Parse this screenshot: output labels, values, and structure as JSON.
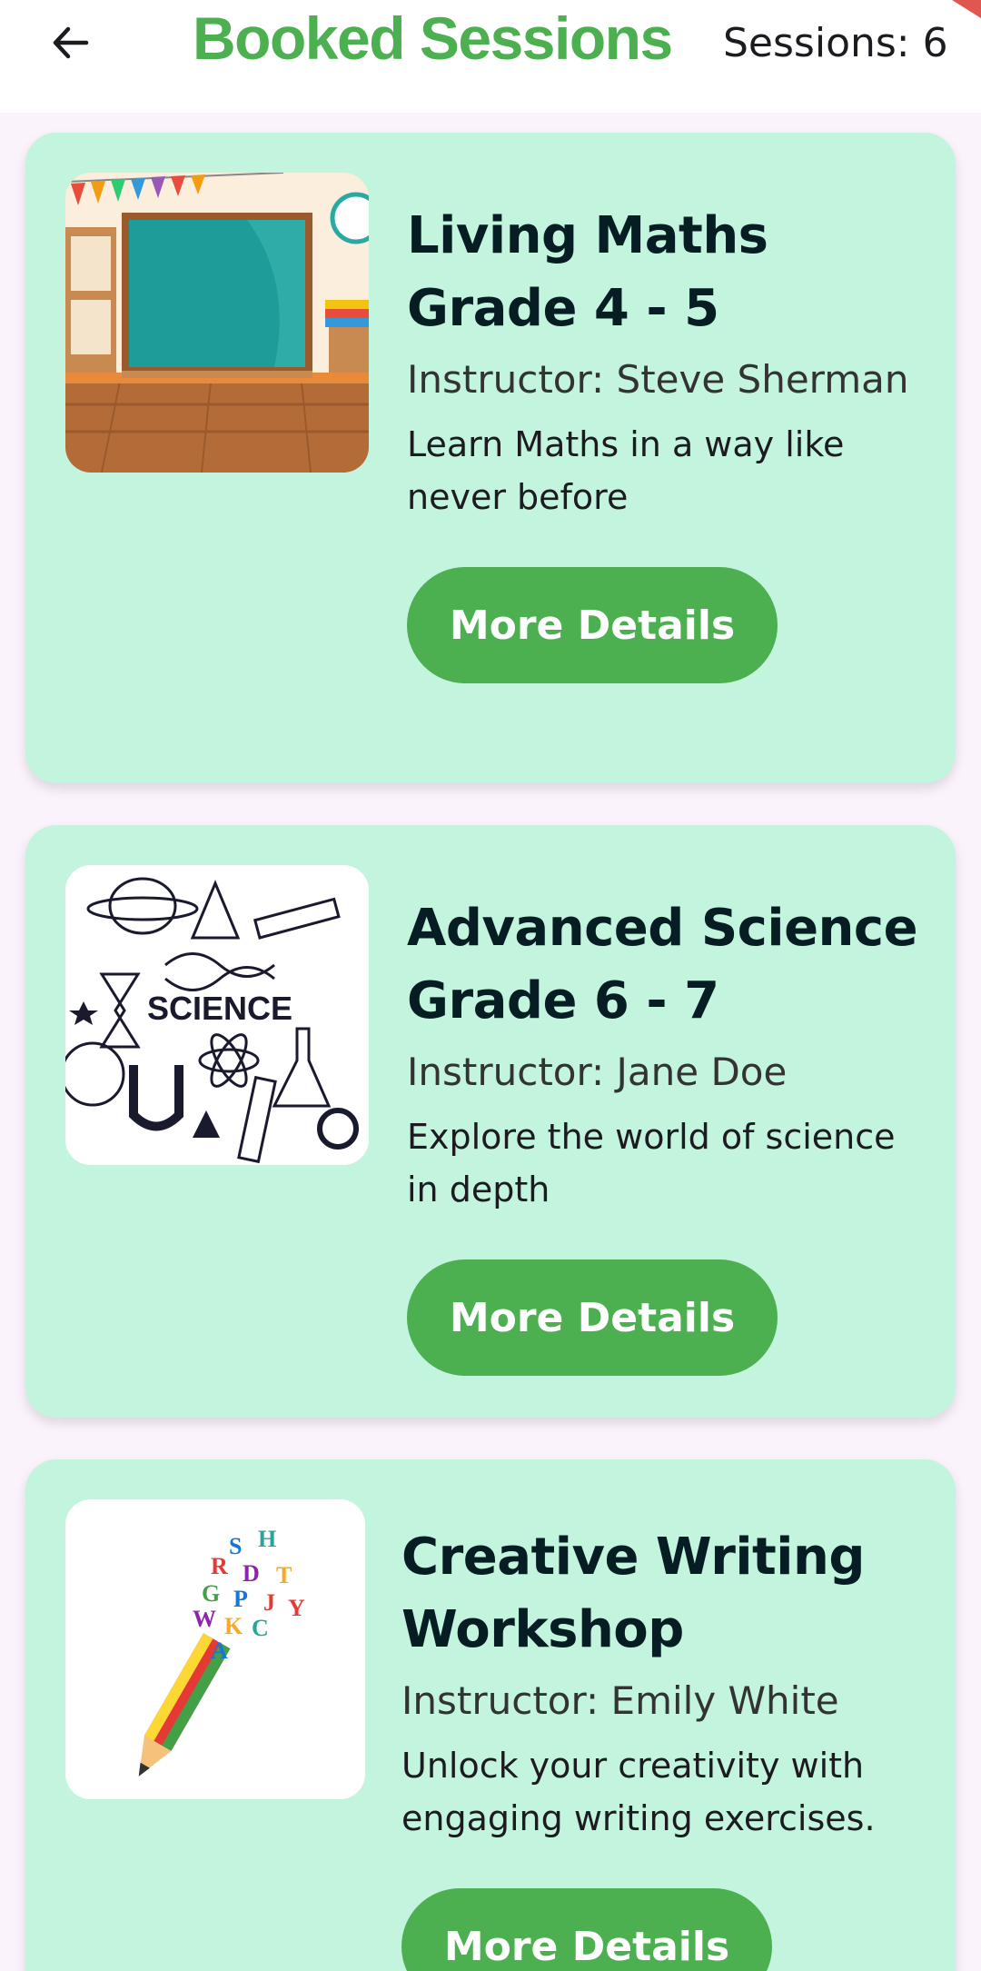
{
  "header": {
    "title": "Booked Sessions",
    "count_label": "Sessions: 6"
  },
  "sessions": [
    {
      "title": "Living Maths Grade 4 - 5",
      "instructor": "Instructor: Steve Sherman",
      "description": "Learn Maths in a way like never before",
      "button_label": "More Details"
    },
    {
      "title": "Advanced Science Grade 6 - 7",
      "instructor": "Instructor: Jane Doe",
      "description": "Explore the world of science in depth",
      "button_label": "More Details"
    },
    {
      "title": "Creative Writing Workshop",
      "instructor": "Instructor: Emily White",
      "description": "Unlock your creativity with engaging writing exercises.",
      "button_label": "More Details"
    }
  ],
  "thumb_labels": {
    "science": "SCIENCE"
  },
  "icons": {
    "back": "back-arrow-icon"
  },
  "colors": {
    "accent": "#4caf50",
    "card": "#c3f4de",
    "background": "#fbf3fb"
  }
}
